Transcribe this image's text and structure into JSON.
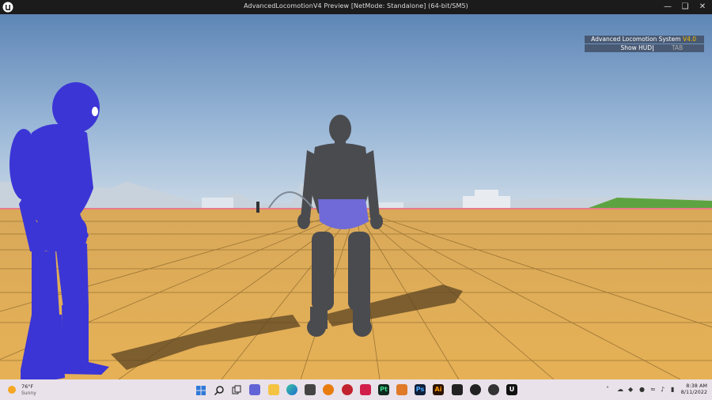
{
  "window": {
    "title": "AdvancedLocomotionV4 Preview [NetMode: Standalone]  (64-bit/SM5)",
    "controls": [
      "minimize-icon",
      "restore-icon",
      "close-icon"
    ]
  },
  "hud": {
    "title": "Advanced Locomotion System",
    "version": "V4.0",
    "toggle_label": "Show HUD",
    "toggle_key": "TAB",
    "version_color": "#f2c200"
  },
  "taskbar": {
    "weather": {
      "temp": "76°F",
      "condition": "Sunny"
    },
    "apps": [
      "windows-start-icon",
      "search-icon",
      "task-view-icon",
      "chat-icon",
      "file-explorer-icon",
      "edge-icon",
      "unity-icon",
      "blender-icon",
      "app-red-icon",
      "app-red2-icon",
      "pt-icon",
      "app-orange-icon",
      "photoshop-icon",
      "illustrator-icon",
      "app-dark-icon",
      "app-dark2-icon",
      "app-dark3-icon",
      "unreal-engine-icon"
    ],
    "app_labels": {
      "pt": "Pt",
      "photoshop": "Ps",
      "illustrator": "Ai"
    },
    "clock": {
      "time": "8:38 AM",
      "date": "8/11/2022"
    }
  }
}
